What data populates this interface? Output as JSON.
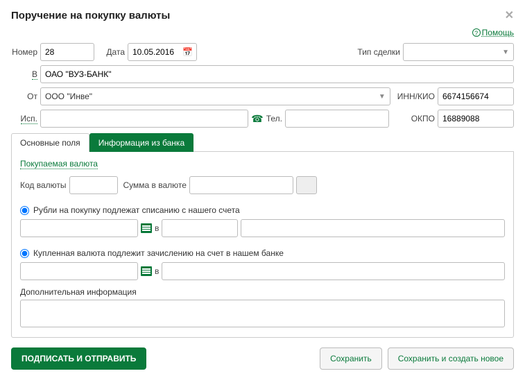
{
  "dialog": {
    "title": "Поручение на покупку валюты"
  },
  "help": {
    "label": "Помощь"
  },
  "header": {
    "number_label": "Номер",
    "number_value": "28",
    "date_label": "Дата",
    "date_value": "10.05.2016",
    "deal_type_label": "Тип сделки",
    "deal_type_value": ""
  },
  "parties": {
    "in_label": "В",
    "bank_value": "ОАО \"ВУЗ-БАНК\"",
    "from_label": "От",
    "from_value": "ООО \"Инве\"",
    "inn_label": "ИНН/КИО",
    "inn_value": "6674156674",
    "isp_label": "Исп.",
    "isp_value": "",
    "tel_label": "Тел.",
    "tel_value": "",
    "okpo_label": "ОКПО",
    "okpo_value": "16889088"
  },
  "tabs": {
    "main": "Основные поля",
    "bank": "Информация из банка"
  },
  "purchase": {
    "section_title": "Покупаемая валюта",
    "code_label": "Код валюты",
    "code_value": "",
    "amount_label": "Сумма в валюте",
    "amount_value": ""
  },
  "debit": {
    "radio_label": "Рубли на покупку подлежат списанию с нашего счета",
    "acct_value": "",
    "in_label": "в",
    "bank_value": ""
  },
  "credit": {
    "radio_label": "Купленная валюта подлежит зачислению на счет в нашем банке",
    "acct_value": "",
    "in_label": "в",
    "bank_value": ""
  },
  "addinfo": {
    "label": "Дополнительная информация",
    "value": ""
  },
  "buttons": {
    "sign_send": "ПОДПИСАТЬ И ОТПРАВИТЬ",
    "save": "Сохранить",
    "save_new": "Сохранить и создать новое"
  }
}
